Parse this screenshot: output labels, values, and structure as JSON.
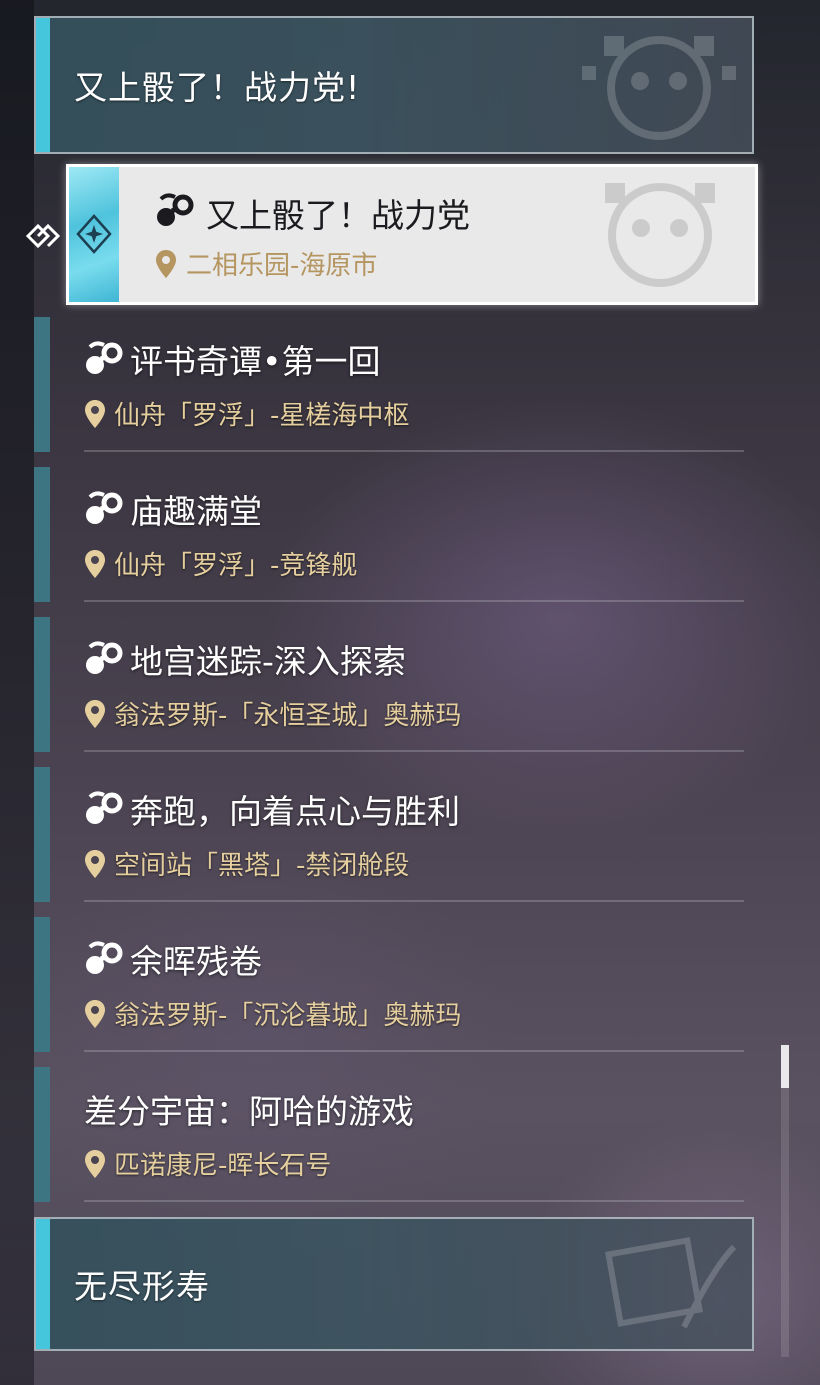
{
  "groups": [
    {
      "title": "又上骰了！战力党!"
    },
    {
      "title": "无尽形寿"
    }
  ],
  "selected_item": {
    "name": "又上骰了！战力党",
    "location": "二相乐园-海原市"
  },
  "items": [
    {
      "name": "评书奇谭•第一回",
      "location": "仙舟「罗浮」-星槎海中枢",
      "has_icon": true
    },
    {
      "name": "庙趣满堂",
      "location": "仙舟「罗浮」-竞锋舰",
      "has_icon": true
    },
    {
      "name": "地宫迷踪-深入探索",
      "location": "翁法罗斯-「永恒圣城」奥赫玛",
      "has_icon": true
    },
    {
      "name": "奔跑，向着点心与胜利",
      "location": "空间站「黑塔」-禁闭舱段",
      "has_icon": true
    },
    {
      "name": "余晖残卷",
      "location": "翁法罗斯-「沉沦暮城」奥赫玛",
      "has_icon": true
    },
    {
      "name": "差分宇宙：阿哈的游戏",
      "location": "匹诺康尼-晖长石号",
      "has_icon": false
    }
  ],
  "icons": {
    "activity": "activity-link-icon",
    "location": "location-pin-icon",
    "selected_marker": "selection-diamond-icon",
    "emblem": "mascot-emblem-icon"
  },
  "colors": {
    "accent_cyan": "#45c6dc",
    "item_bar": "#3e7582",
    "location_gold": "#e6cf9e",
    "selected_location": "#b59560"
  }
}
